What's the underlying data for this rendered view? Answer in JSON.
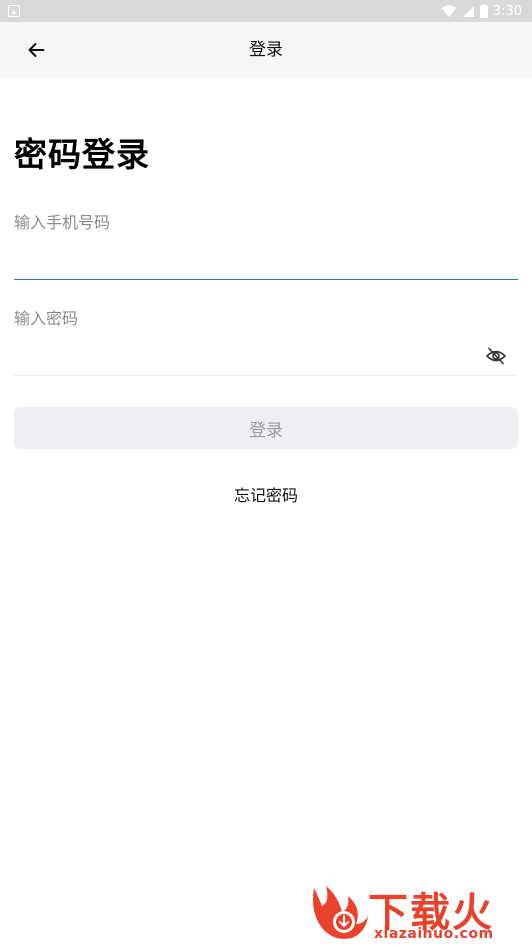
{
  "status_bar": {
    "time": "3:30",
    "icons": [
      "notification-icon",
      "wifi-icon",
      "signal-icon",
      "battery-icon"
    ]
  },
  "app_bar": {
    "title": "登录",
    "back_icon": "back-arrow-icon"
  },
  "login_form": {
    "heading": "密码登录",
    "phone": {
      "label": "输入手机号码",
      "value": ""
    },
    "password": {
      "label": "输入密码",
      "value": "",
      "toggle_icon": "eye-hidden-icon"
    },
    "submit_label": "登录",
    "forgot_label": "忘记密码"
  },
  "watermark": {
    "text": "下载火",
    "domain": "xiazaihuo.com"
  },
  "colors": {
    "accent_underline": "#2f7f8f",
    "button_bg": "#efeff3",
    "watermark": "#e8412c"
  }
}
